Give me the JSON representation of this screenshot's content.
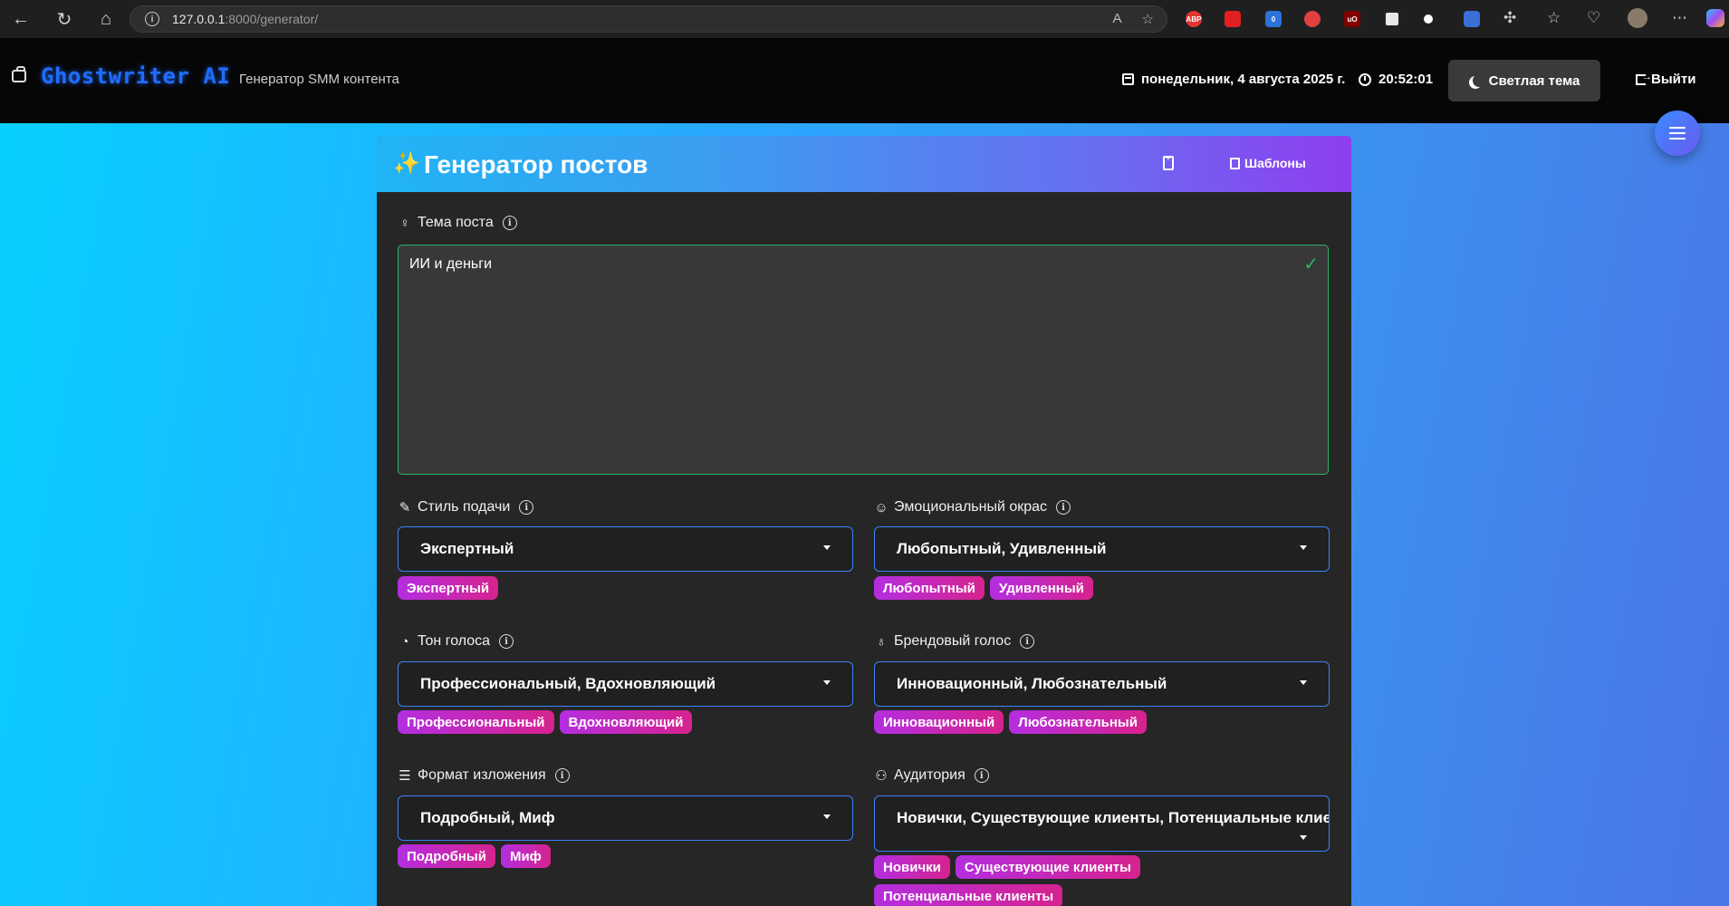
{
  "browser": {
    "url_host": "127.0.0.1",
    "url_path": ":8000/generator/",
    "extensions": [
      {
        "name": "adblock-icon",
        "label": "ABP",
        "color": "#e3342f"
      },
      {
        "name": "stop-icon",
        "label": "",
        "color": "#e02020"
      },
      {
        "name": "ext-badge-icon",
        "label": "0",
        "color": "#2a73d9"
      },
      {
        "name": "red-ext-icon",
        "label": "",
        "color": "#e04040"
      },
      {
        "name": "ublock-icon",
        "label": "uO",
        "color": "#800000"
      },
      {
        "name": "square-ext-icon",
        "label": "",
        "color": "#e8e8e8"
      },
      {
        "name": "dot-ext-icon",
        "label": "",
        "color": "#ffffff"
      },
      {
        "name": "blue-ext-icon",
        "label": "",
        "color": "#3a6fd8"
      }
    ]
  },
  "header": {
    "brand": "Ghostwriter AI",
    "subtitle": "Генератор SMM контента",
    "date": "понедельник, 4 августа 2025 г.",
    "time": "20:52:01",
    "theme_button": "Светлая тема",
    "logout": "Выйти"
  },
  "card": {
    "title": "Генератор постов",
    "templates_button": "Шаблоны"
  },
  "form": {
    "topic": {
      "label": "Тема поста",
      "value": "ИИ и деньги"
    },
    "style": {
      "label": "Стиль подачи",
      "value": "Экспертный",
      "tags": [
        "Экспертный"
      ]
    },
    "emotion": {
      "label": "Эмоциональный окрас",
      "value": "Любопытный, Удивленный",
      "tags": [
        "Любопытный",
        "Удивленный"
      ]
    },
    "tone": {
      "label": "Тон голоса",
      "value": "Профессиональный, Вдохновляющий",
      "tags": [
        "Профессиональный",
        "Вдохновляющий"
      ]
    },
    "brand_voice": {
      "label": "Брендовый голос",
      "value": "Инновационный, Любознательный",
      "tags": [
        "Инновационный",
        "Любознательный"
      ]
    },
    "format": {
      "label": "Формат изложения",
      "value": "Подробный, Миф",
      "tags": [
        "Подробный",
        "Миф"
      ]
    },
    "audience": {
      "label": "Аудитория",
      "value": "Новички, Существующие клиенты, Потенциальные клиенты",
      "tags": [
        "Новички",
        "Существующие клиенты",
        "Потенциальные клиенты"
      ]
    }
  },
  "colors": {
    "brand_blue": "#1e6dff",
    "tag_gradient_start": "#b42ee0",
    "tag_gradient_end": "#d6238e",
    "valid_green": "#2bb56a",
    "select_border": "#3b82f6"
  }
}
